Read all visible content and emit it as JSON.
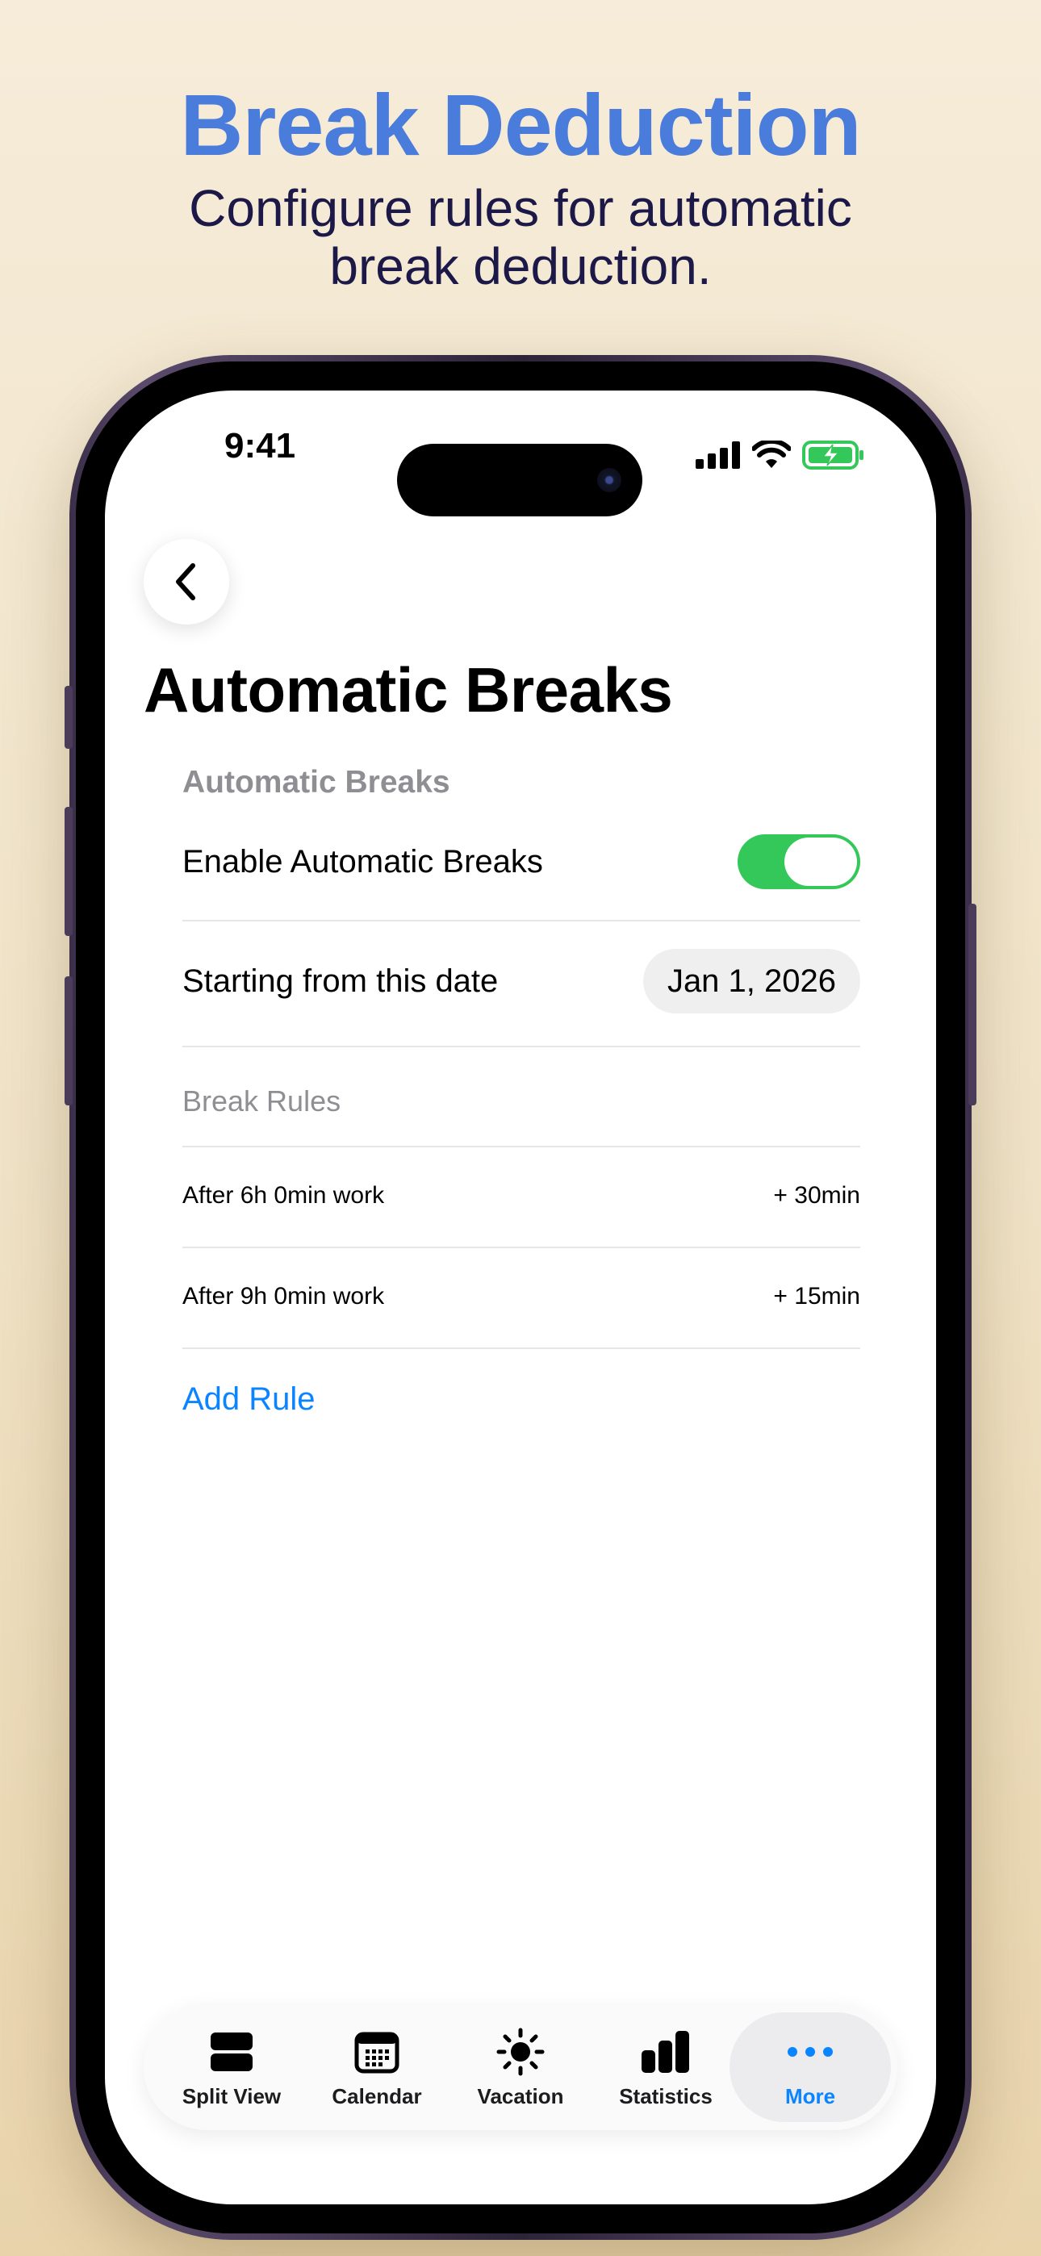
{
  "promo": {
    "title": "Break Deduction",
    "subtitle": "Configure rules for automatic break deduction."
  },
  "status_bar": {
    "time": "9:41",
    "icons": [
      "signal-icon",
      "wifi-icon",
      "battery-charging-icon"
    ]
  },
  "navigation": {
    "back_icon": "chevron-left-icon",
    "title": "Automatic Breaks"
  },
  "automatic_breaks_section": {
    "header": "Automatic Breaks",
    "enable_label": "Enable Automatic Breaks",
    "enabled": true,
    "start_date_label": "Starting from this date",
    "start_date_value": "Jan 1, 2026"
  },
  "break_rules": {
    "header": "Break Rules",
    "rules": [
      {
        "condition": "After 6h 0min work",
        "deduction": "+ 30min"
      },
      {
        "condition": "After 9h 0min work",
        "deduction": "+ 15min"
      }
    ],
    "add_rule_label": "Add Rule"
  },
  "tab_bar": {
    "tabs": [
      {
        "label": "Split View",
        "icon": "split-view-icon",
        "active": false
      },
      {
        "label": "Calendar",
        "icon": "calendar-icon",
        "active": false
      },
      {
        "label": "Vacation",
        "icon": "sun-icon",
        "active": false
      },
      {
        "label": "Statistics",
        "icon": "bar-chart-icon",
        "active": false
      },
      {
        "label": "More",
        "icon": "more-dots-icon",
        "active": true
      }
    ]
  },
  "colors": {
    "promo_title": "#4a7cdc",
    "promo_subtitle": "#1c1848",
    "toggle_on": "#34c759",
    "accent": "#0a84ff",
    "battery": "#34c759"
  }
}
